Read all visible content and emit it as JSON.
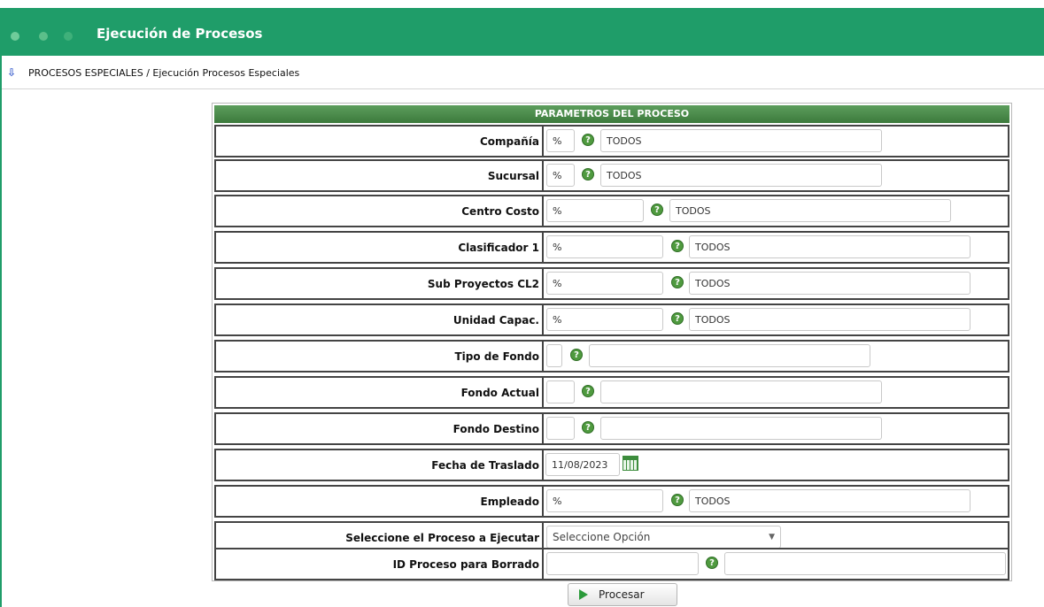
{
  "window": {
    "title": "Ejecución de Procesos"
  },
  "breadcrumb": {
    "text": "PROCESOS ESPECIALES / Ejecución Procesos Especiales"
  },
  "panel": {
    "header": "PARAMETROS DEL PROCESO",
    "rows": {
      "compania": {
        "label": "Compañía",
        "code": "%",
        "desc": "TODOS"
      },
      "sucursal": {
        "label": "Sucursal",
        "code": "%",
        "desc": "TODOS"
      },
      "centro_costo": {
        "label": "Centro Costo",
        "code": "%",
        "desc": "TODOS"
      },
      "clasificador1": {
        "label": "Clasificador 1",
        "code": "%",
        "desc": "TODOS"
      },
      "subproyectos": {
        "label": "Sub Proyectos CL2",
        "code": "%",
        "desc": "TODOS"
      },
      "unidad_capac": {
        "label": "Unidad Capac.",
        "code": "%",
        "desc": "TODOS"
      },
      "tipo_fondo": {
        "label": "Tipo de Fondo",
        "code": "",
        "desc": ""
      },
      "fondo_actual": {
        "label": "Fondo Actual",
        "code": "",
        "desc": ""
      },
      "fondo_destino": {
        "label": "Fondo Destino",
        "code": "",
        "desc": ""
      },
      "fecha_traslado": {
        "label": "Fecha de Traslado",
        "value": "11/08/2023"
      },
      "empleado": {
        "label": "Empleado",
        "code": "%",
        "desc": "TODOS"
      },
      "proceso": {
        "label": "Seleccione el Proceso a Ejecutar",
        "selected": "Seleccione Opción"
      },
      "id_borrado": {
        "label": "ID Proceso para Borrado",
        "code": "",
        "desc": ""
      }
    }
  },
  "actions": {
    "procesar": "Procesar"
  },
  "colors": {
    "titlebar": "#1f9d69",
    "panel_header": "#4a8a4a",
    "help_icon": "#4f9a3f"
  },
  "icons": {
    "help": "help-circle-icon",
    "calendar": "calendar-icon",
    "play": "play-icon",
    "breadcrumb": "info-arrow-icon"
  }
}
